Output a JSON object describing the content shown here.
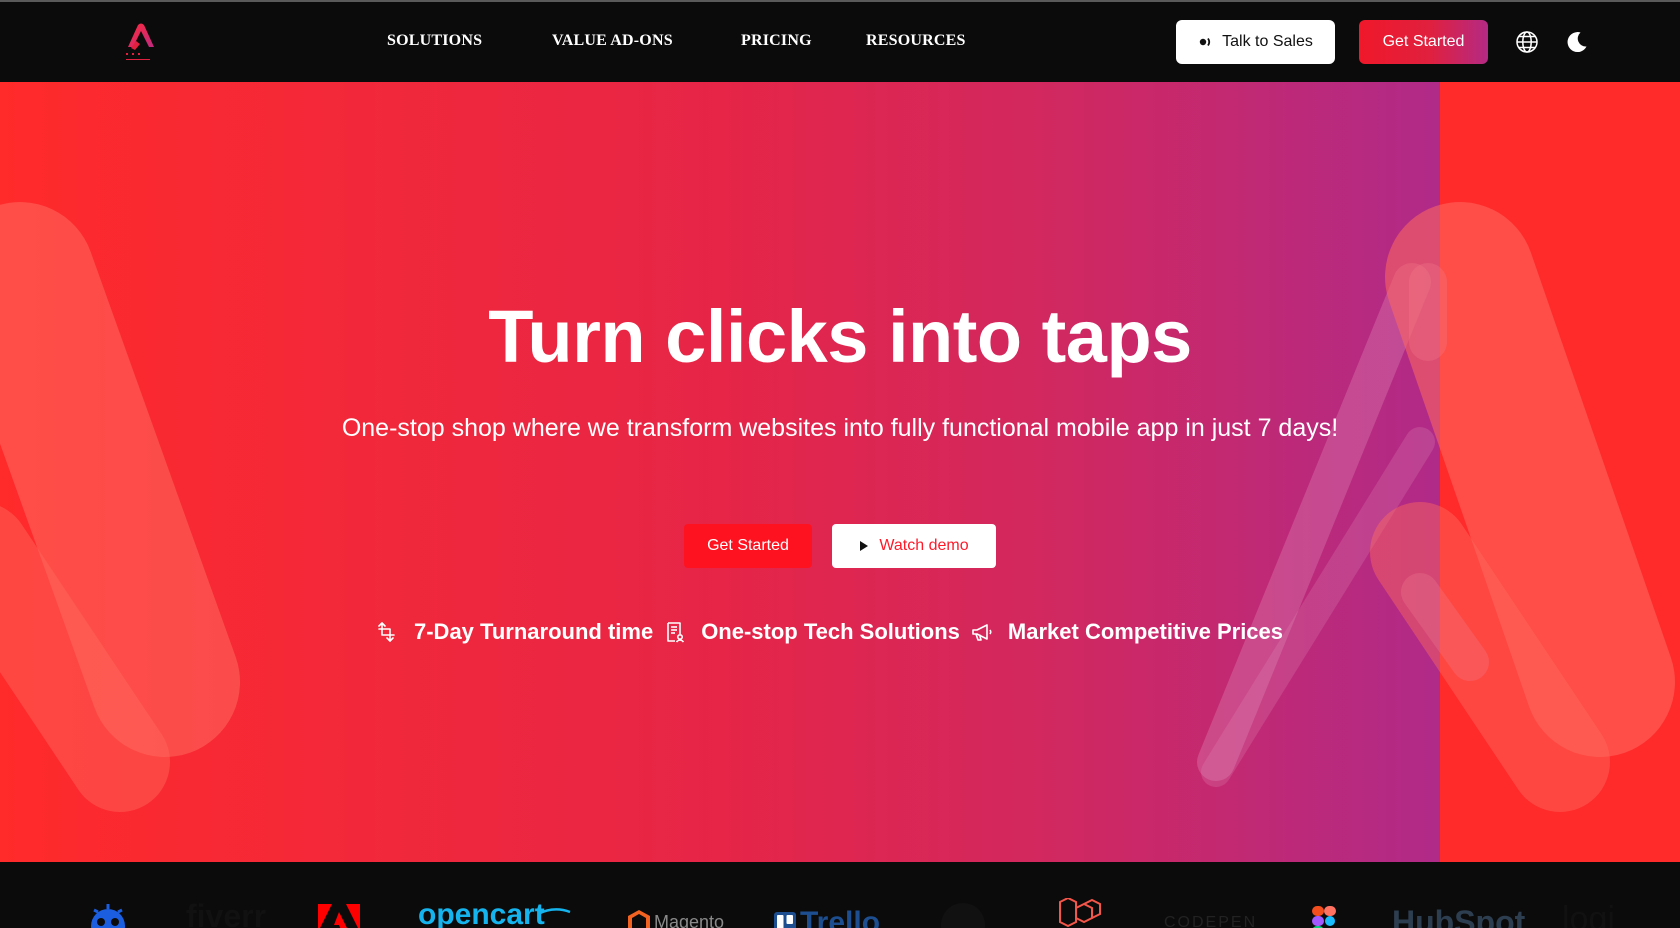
{
  "nav": {
    "links": [
      "SOLUTIONS",
      "VALUE AD-ONS",
      "PRICING",
      "RESOURCES"
    ],
    "talk_to_sales": "Talk to Sales",
    "get_started": "Get Started",
    "globe_icon": "globe-icon",
    "theme_icon": "moon-icon"
  },
  "hero": {
    "title": "Turn clicks into taps",
    "subtitle": "One-stop shop where we transform websites into fully functional mobile app in just 7 days!",
    "get_started": "Get Started",
    "watch_demo": "Watch demo",
    "features": [
      {
        "icon": "turnaround-icon",
        "label": "7-Day Turnaround time"
      },
      {
        "icon": "document-icon",
        "label": "One-stop Tech Solutions"
      },
      {
        "icon": "megaphone-icon",
        "label": "Market Competitive Prices"
      }
    ]
  },
  "brands": {
    "fiverr": "fiverr",
    "opencart": "opencart",
    "magento": "Magento",
    "trello": "Trello",
    "codepen": "CODEPEN",
    "hubspot": "HubSpot",
    "logi": "logi"
  },
  "colors": {
    "brand_red": "#ff1220",
    "gradient_end": "#b02a88",
    "nav_bg": "#0b0b0b"
  }
}
